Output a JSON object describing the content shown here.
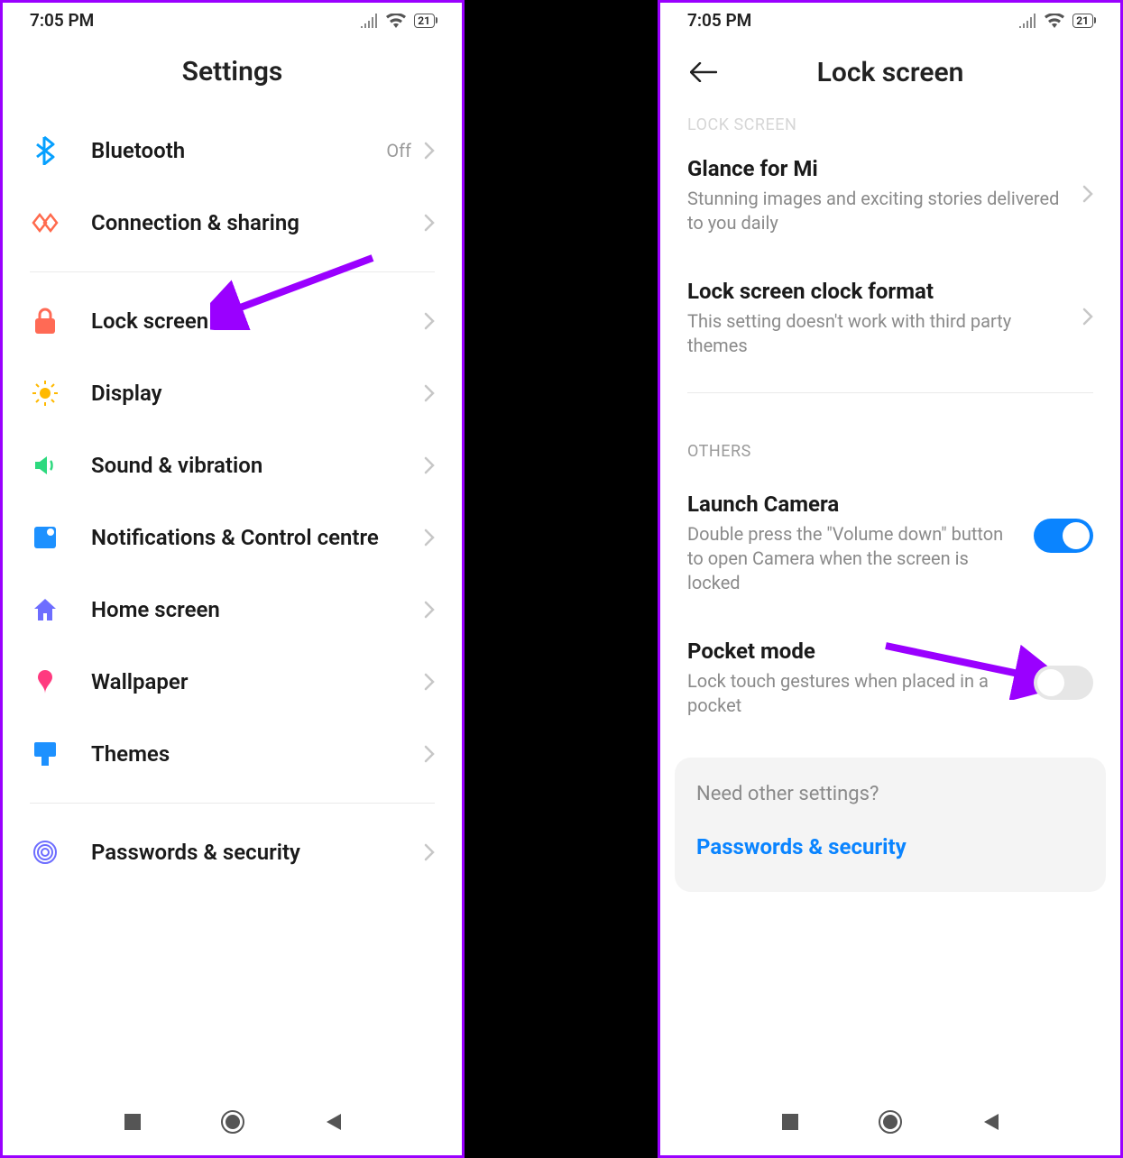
{
  "status": {
    "time": "7:05 PM",
    "battery": "21"
  },
  "left": {
    "title": "Settings",
    "items": [
      {
        "icon": "bluetooth-icon",
        "label": "Bluetooth",
        "value": "Off",
        "color": "#06a0ff"
      },
      {
        "icon": "connection-icon",
        "label": "Connection & sharing",
        "color": "#ff6a4d"
      }
    ],
    "items2": [
      {
        "icon": "lock-icon",
        "label": "Lock screen",
        "color": "#ff6a55"
      },
      {
        "icon": "sun-icon",
        "label": "Display",
        "color": "#ffb900"
      },
      {
        "icon": "sound-icon",
        "label": "Sound & vibration",
        "color": "#2dd97e"
      },
      {
        "icon": "notif-icon",
        "label": "Notifications & Control centre",
        "color": "#1d91ff"
      },
      {
        "icon": "home-icon",
        "label": "Home screen",
        "color": "#6d6dff"
      },
      {
        "icon": "wallpaper-icon",
        "label": "Wallpaper",
        "color": "#ff3a7f"
      },
      {
        "icon": "theme-icon",
        "label": "Themes",
        "color": "#1d91ff"
      }
    ],
    "items3": [
      {
        "icon": "fingerprint-icon",
        "label": "Passwords & security",
        "color": "#6d6dff"
      }
    ]
  },
  "right": {
    "title": "Lock screen",
    "section_truncated": "LOCK SCREEN",
    "details": [
      {
        "title": "Glance for Mi",
        "desc": "Stunning images and exciting stories delivered to you daily",
        "trailing": "chevron"
      },
      {
        "title": "Lock screen clock format",
        "desc": "This setting doesn't work with third party themes",
        "trailing": "chevron"
      }
    ],
    "section2": "OTHERS",
    "details2": [
      {
        "title": "Launch Camera",
        "desc": "Double press the \"Volume down\" button to open Camera when the screen is locked",
        "trailing": "toggle",
        "on": true
      },
      {
        "title": "Pocket mode",
        "desc": "Lock touch gestures when placed in a pocket",
        "trailing": "toggle",
        "on": false
      }
    ],
    "card": {
      "heading": "Need other settings?",
      "link": "Passwords & security"
    }
  },
  "annotations": {
    "arrow_color": "#9a00ff"
  }
}
